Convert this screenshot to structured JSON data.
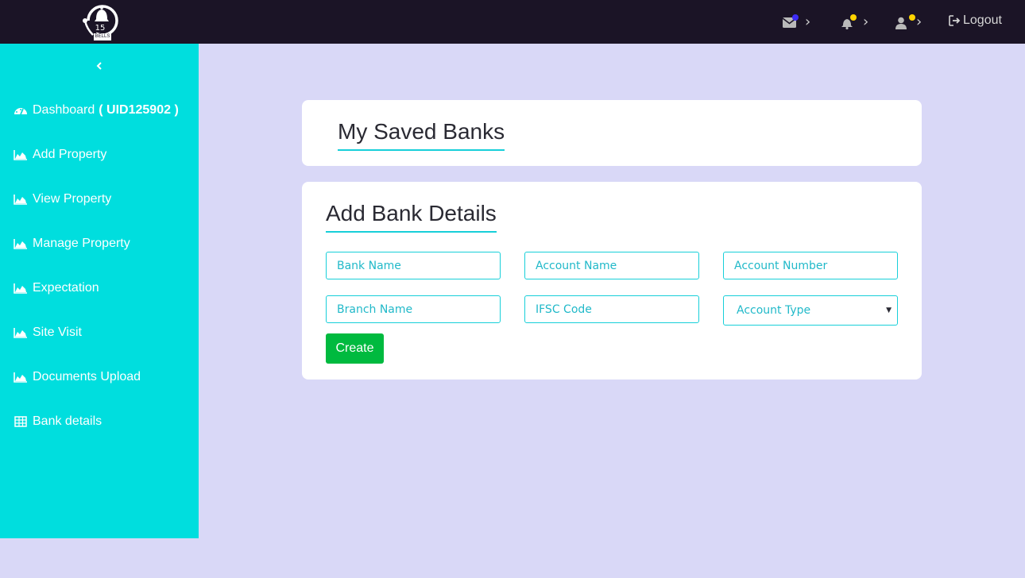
{
  "logo": {
    "number": "15",
    "tag": "BELLS"
  },
  "topbar": {
    "messages_icon": "envelope-icon",
    "notifications_icon": "bell-icon",
    "user_icon": "user-icon",
    "chevron": "›",
    "logout_label": "Logout",
    "dot_colors": {
      "messages": "#3d2cf5",
      "notifications": "#ffd400",
      "user": "#ffd400"
    }
  },
  "sidebar": {
    "collapse_icon": "chevron-left-icon",
    "dashboard": {
      "label": "Dashboard",
      "uid": "( UID125902 )"
    },
    "items": [
      {
        "label": "Add Property",
        "icon": "area-chart-icon"
      },
      {
        "label": "View Property",
        "icon": "area-chart-icon"
      },
      {
        "label": "Manage Property",
        "icon": "area-chart-icon"
      },
      {
        "label": "Expectation",
        "icon": "area-chart-icon"
      },
      {
        "label": "Site Visit",
        "icon": "area-chart-icon"
      },
      {
        "label": "Documents Upload",
        "icon": "area-chart-icon"
      },
      {
        "label": "Bank details",
        "icon": "table-icon"
      }
    ]
  },
  "saved_banks": {
    "title": "My Saved Banks"
  },
  "add_bank": {
    "title": "Add Bank Details",
    "fields": {
      "bank_name": "Bank Name",
      "account_name": "Account Name",
      "account_number": "Account Number",
      "branch_name": "Branch Name",
      "ifsc_code": "IFSC Code"
    },
    "account_type": {
      "selected": "Account Type"
    },
    "create_label": "Create"
  },
  "colors": {
    "topbar": "#1b1426",
    "sidebar": "#00dede",
    "background": "#d9d8f7",
    "accent": "#17cfd9",
    "button": "#00ba3f"
  }
}
